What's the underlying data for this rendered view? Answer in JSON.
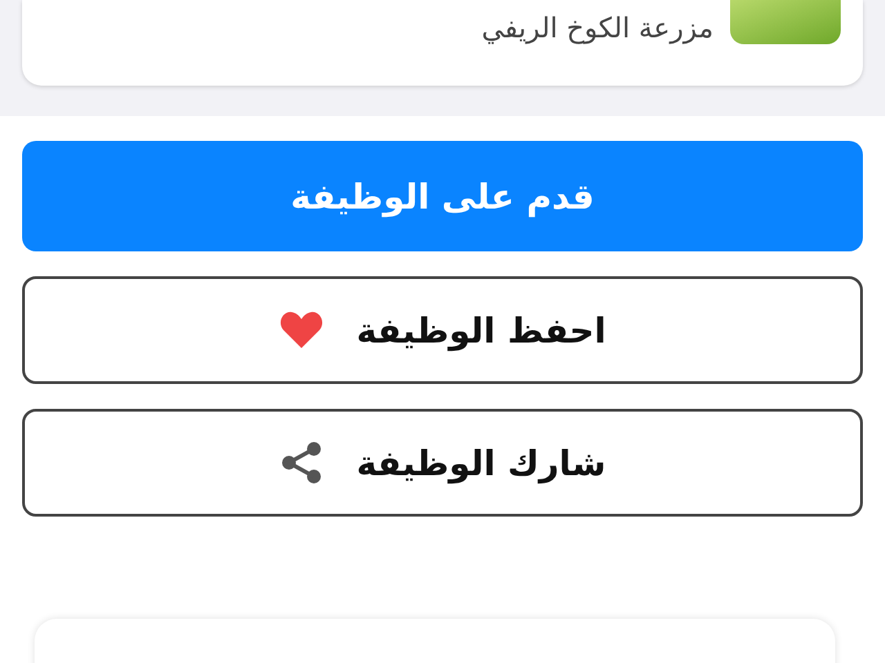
{
  "company": {
    "name": "مزرعة الكوخ الريفي"
  },
  "actions": [
    {
      "kind": "apply",
      "label": "قدم على الوظيفة"
    },
    {
      "kind": "save",
      "label": "احفظ الوظيفة"
    },
    {
      "kind": "share",
      "label": "شارك الوظيفة"
    }
  ]
}
